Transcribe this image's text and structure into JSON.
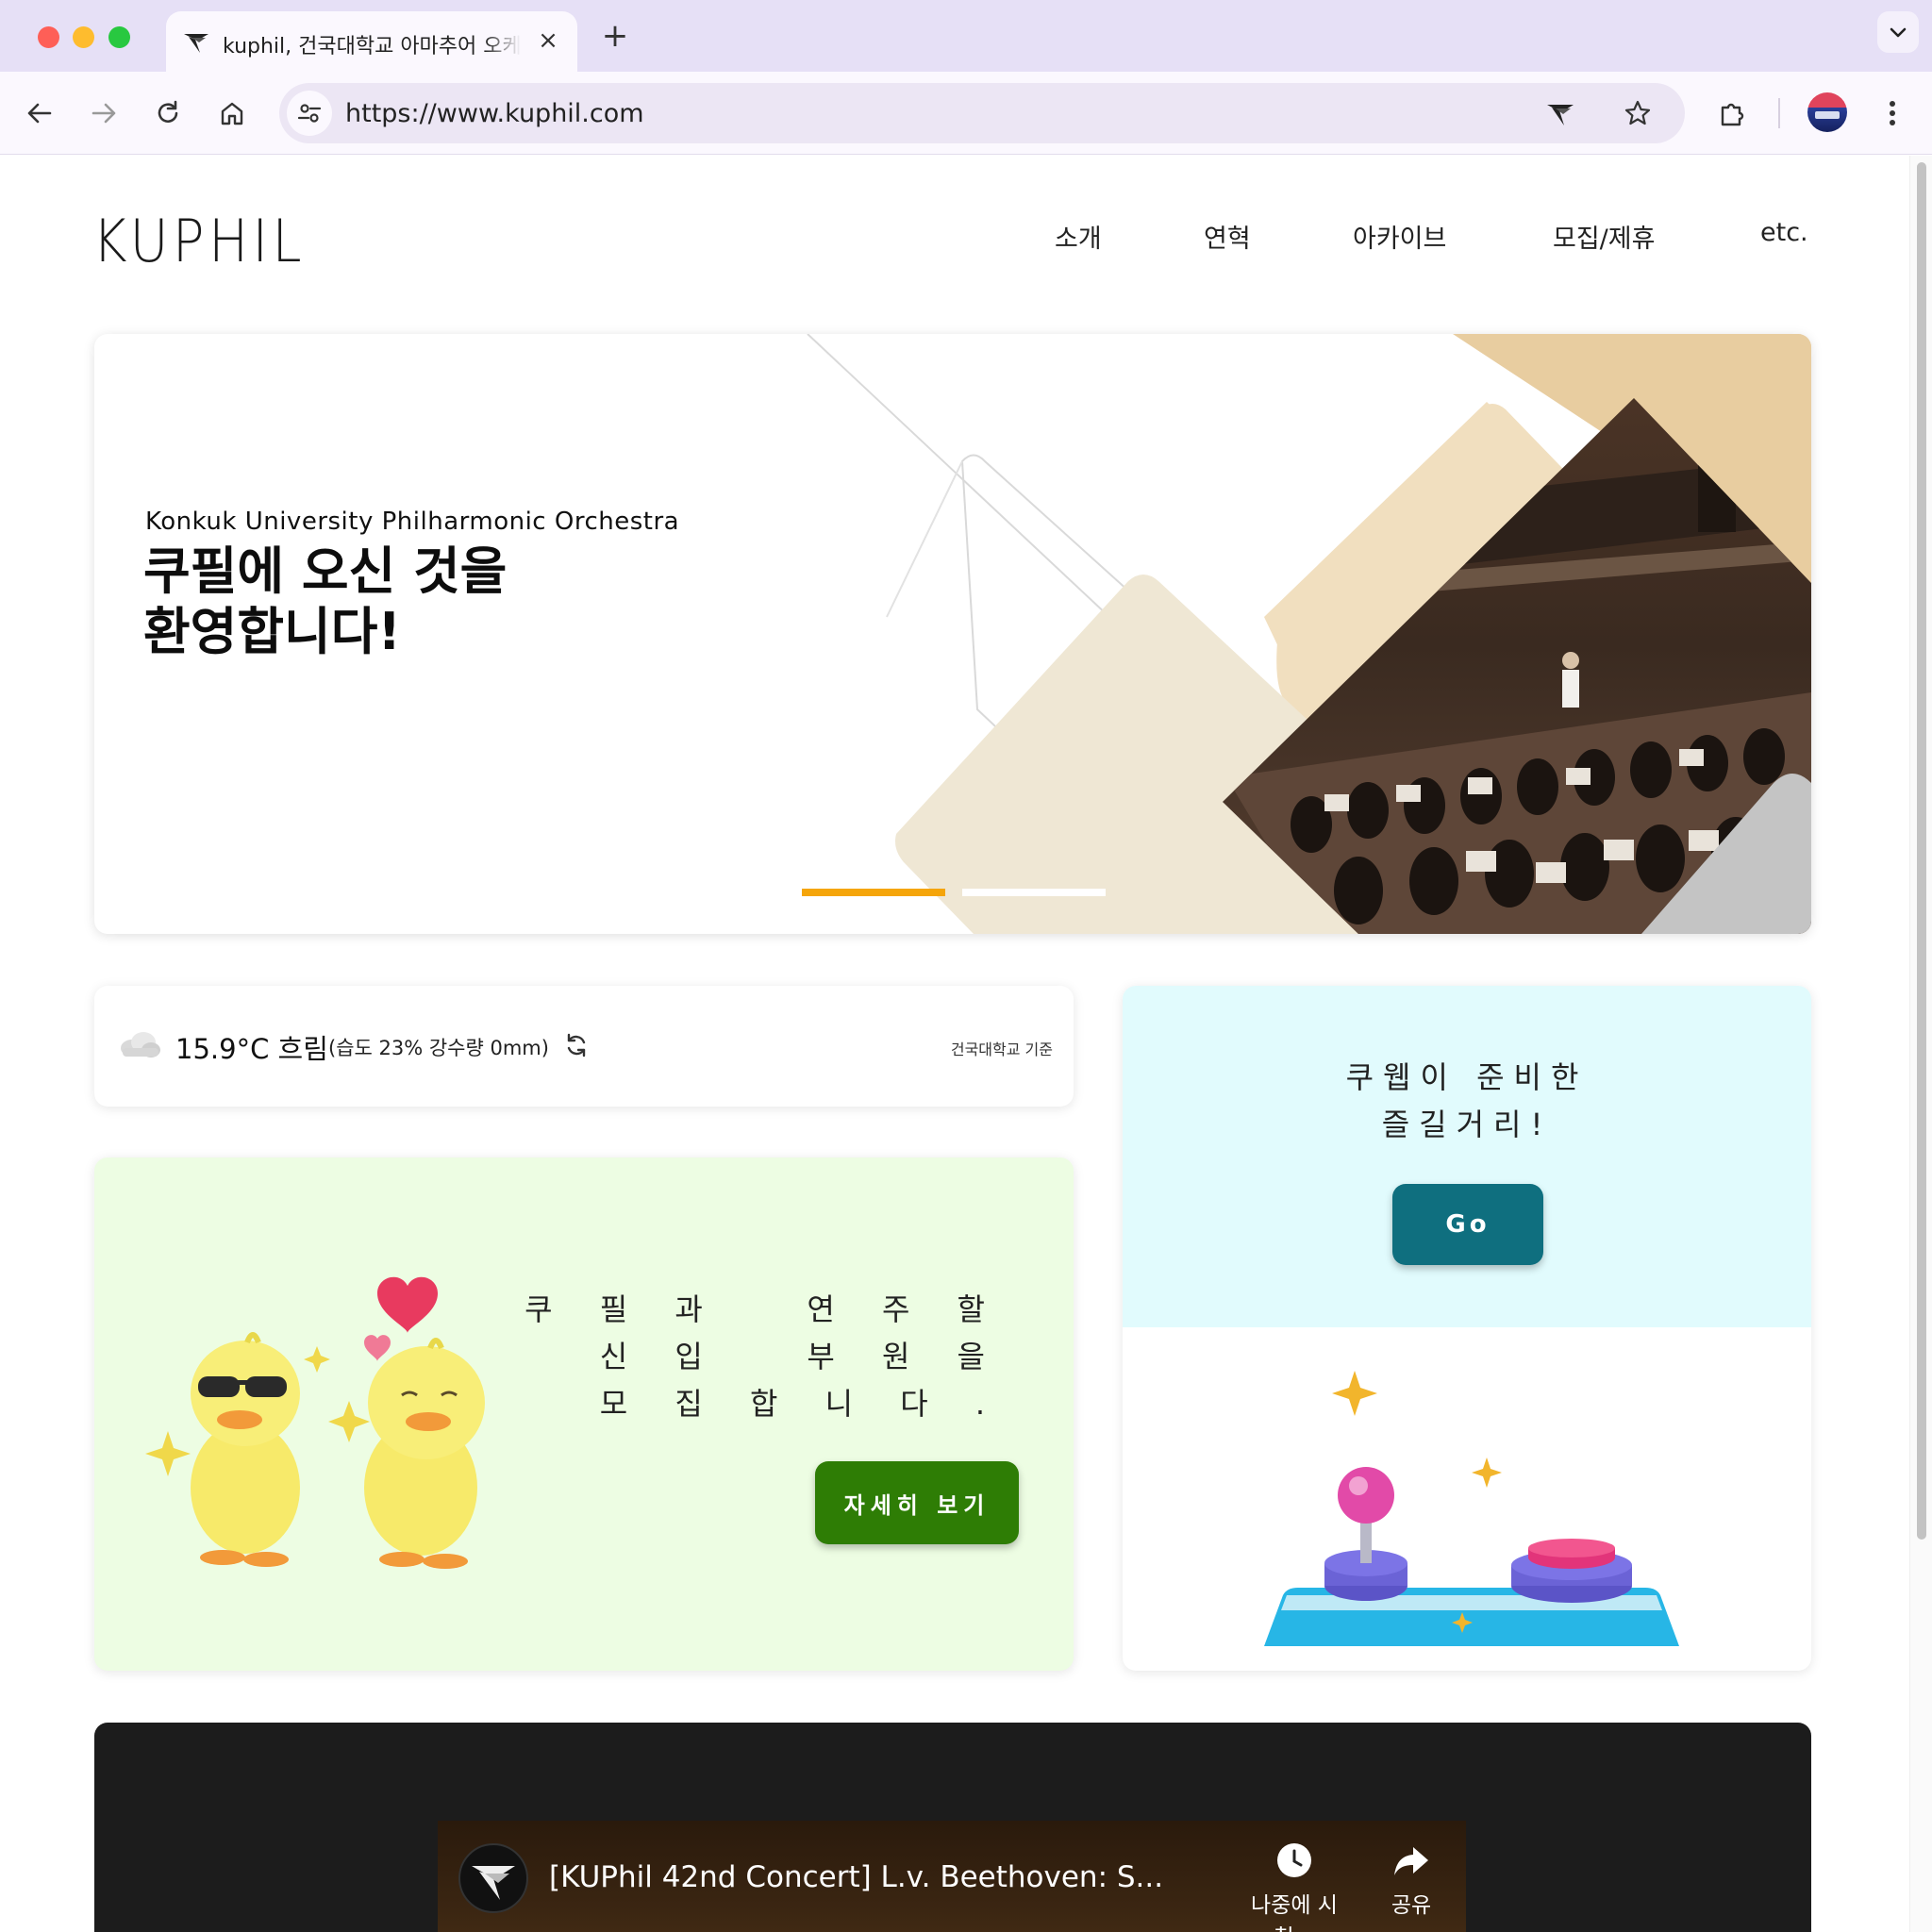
{
  "browser": {
    "tab_title": "kuphil, 건국대학교 아마추어 오케스트라",
    "close_symbol": "×",
    "new_tab_symbol": "+",
    "url": "https://www.kuphil.com"
  },
  "site": {
    "logo": "KUPHIL",
    "nav": [
      "소개",
      "연혁",
      "아카이브",
      "모집/제휴",
      "etc."
    ]
  },
  "hero": {
    "subtitle": "Konkuk University Philharmonic Orchestra",
    "headline_line1": "쿠필에 오신 것을",
    "headline_line2": "환영합니다!",
    "slides": {
      "count": 2,
      "active": 0
    },
    "colors": {
      "accent": "#f5a50a",
      "beige": "#e8cda0",
      "cream": "#efe7d4"
    }
  },
  "weather": {
    "icon": "cloud-icon",
    "temperature_condition": "15.9°C 흐림",
    "details": "(습도 23% 강수량 0mm)",
    "basis": "건국대학교 기준"
  },
  "recruit": {
    "line1": "쿠 필 과   연 주 할",
    "line2": "신 입   부 원 을",
    "line3": "모 집 합 니 다 .",
    "button": "자세히 보기",
    "colors": {
      "background": "#edfde3",
      "button": "#2e7d05"
    }
  },
  "games": {
    "line1": "쿠웹이 준비한",
    "line2": "즐길거리!",
    "button": "Go",
    "colors": {
      "background": "#e1fbfd",
      "button": "#0f6f7f"
    }
  },
  "video": {
    "title": "[KUPhil 42nd Concert] L.v. Beethoven: S...",
    "watch_later": "나중에 시청...",
    "share": "공유"
  }
}
